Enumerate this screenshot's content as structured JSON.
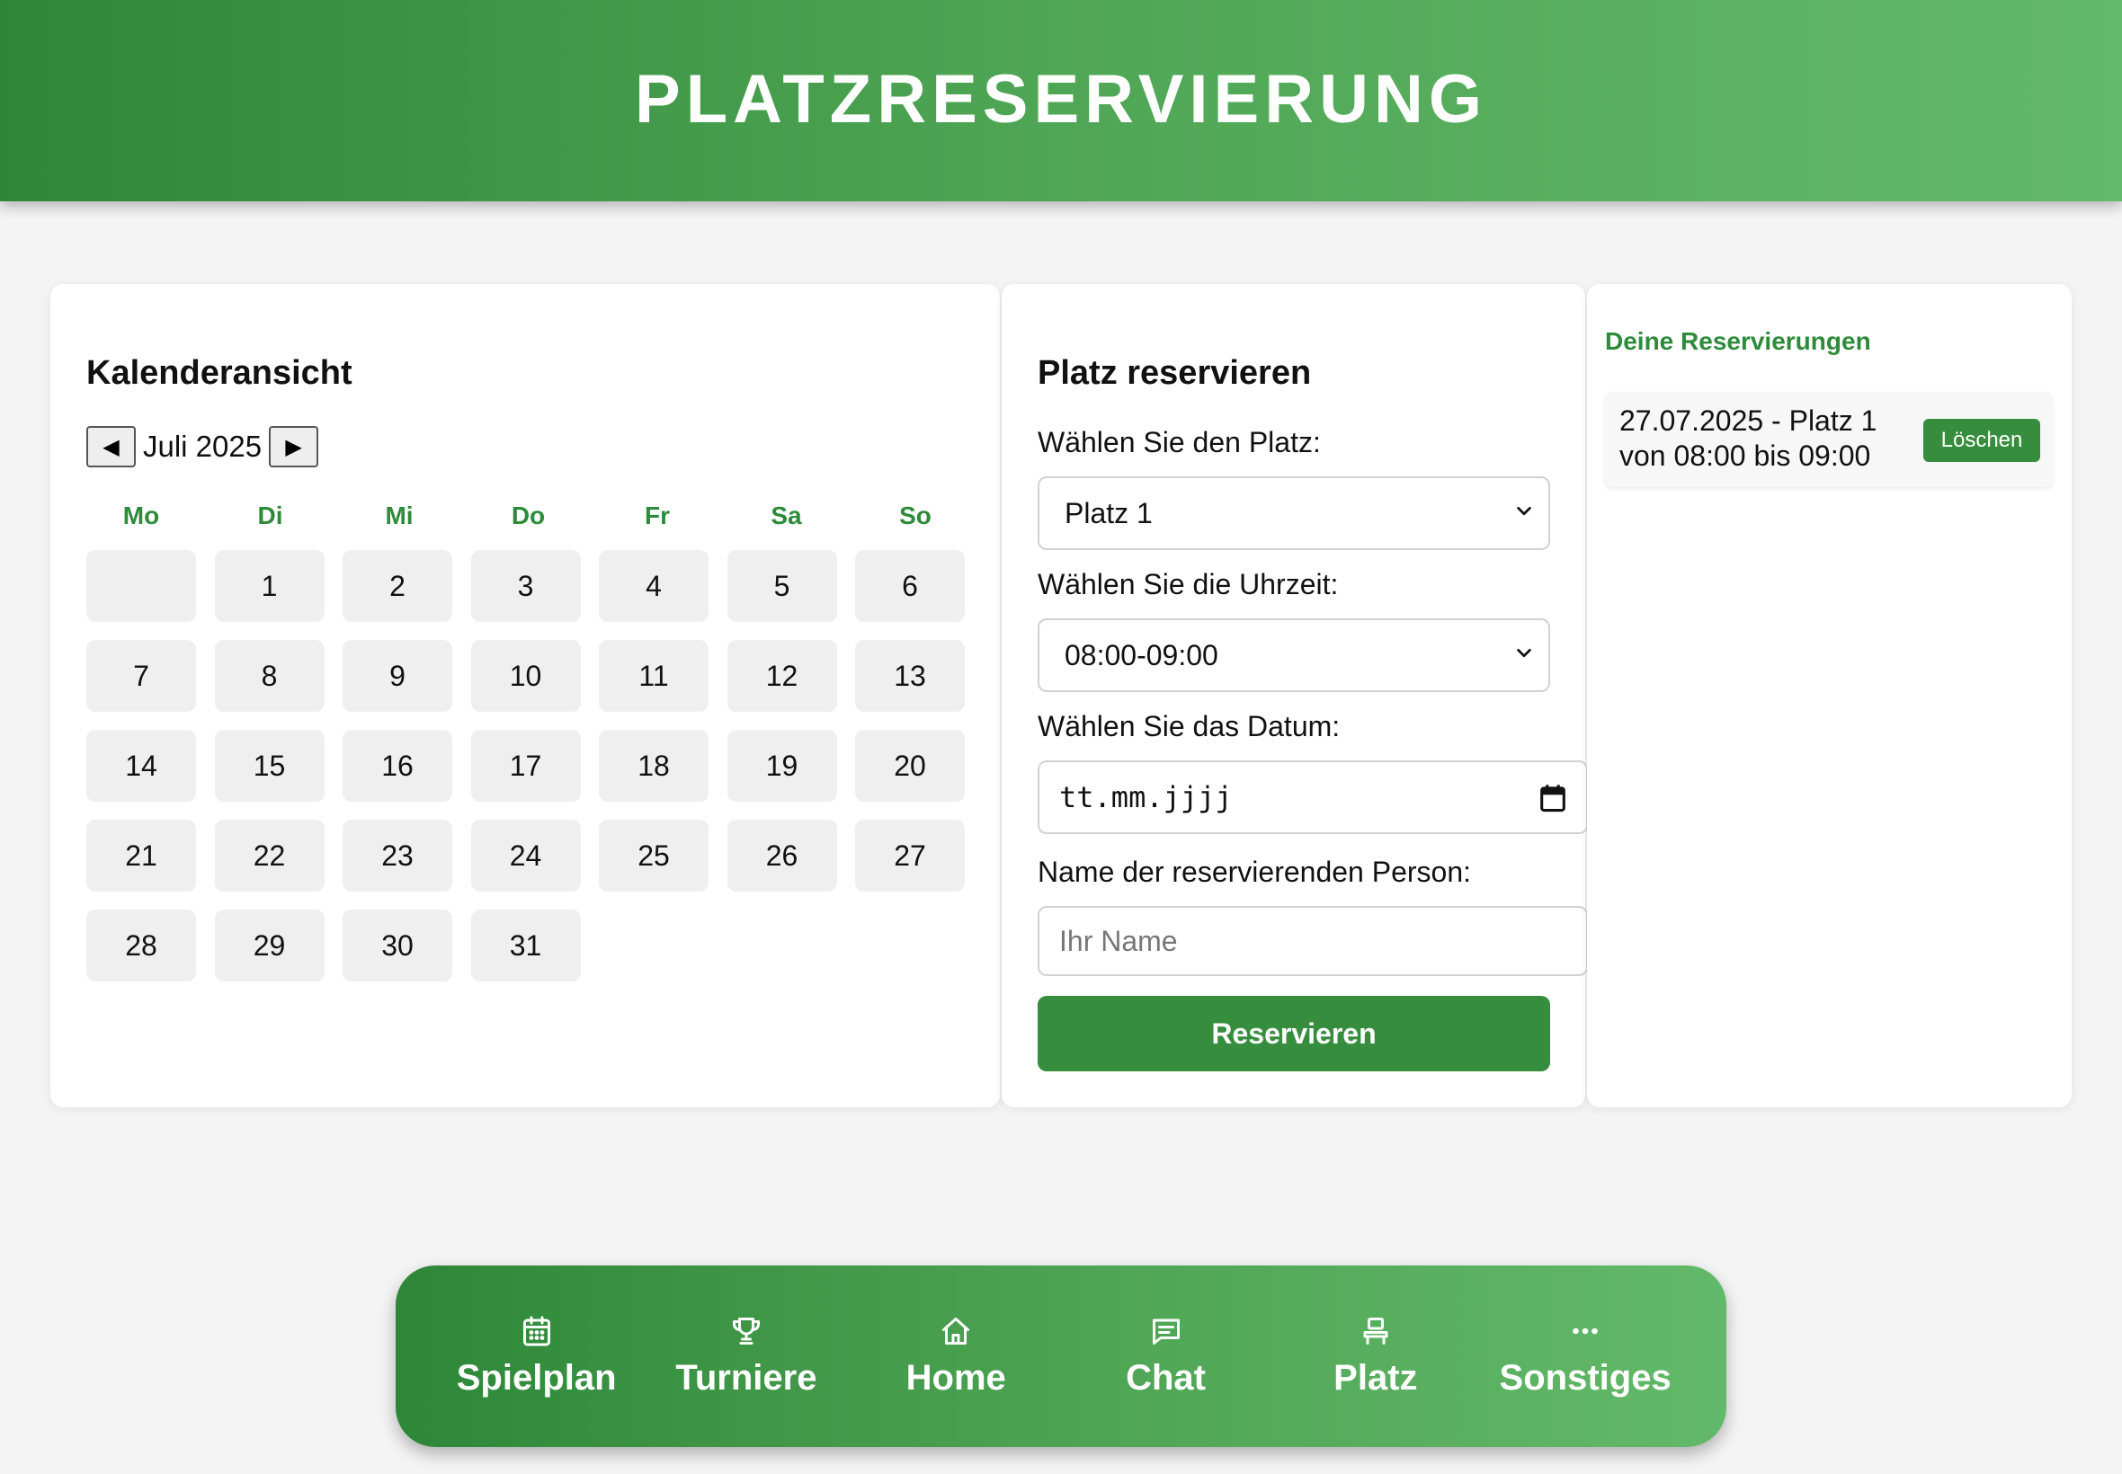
{
  "header": {
    "title": "PLATZRESERVIERUNG"
  },
  "calendar": {
    "title": "Kalenderansicht",
    "prev_symbol": "◀",
    "next_symbol": "▶",
    "month_label": "Juli 2025",
    "weekdays": [
      "Mo",
      "Di",
      "Mi",
      "Do",
      "Fr",
      "Sa",
      "So"
    ],
    "leading_empty": 1,
    "days": [
      "1",
      "2",
      "3",
      "4",
      "5",
      "6",
      "7",
      "8",
      "9",
      "10",
      "11",
      "12",
      "13",
      "14",
      "15",
      "16",
      "17",
      "18",
      "19",
      "20",
      "21",
      "22",
      "23",
      "24",
      "25",
      "26",
      "27",
      "28",
      "29",
      "30",
      "31"
    ]
  },
  "form": {
    "title": "Platz reservieren",
    "court_label": "Wählen Sie den Platz:",
    "court_value": "Platz 1",
    "time_label": "Wählen Sie die Uhrzeit:",
    "time_value": "08:00-09:00",
    "date_label": "Wählen Sie das Datum:",
    "date_placeholder": "tt.mm.jjjj",
    "name_label": "Name der reservierenden Person:",
    "name_placeholder": "Ihr Name",
    "submit_label": "Reservieren"
  },
  "reservations": {
    "title": "Deine Reservierungen",
    "items": [
      {
        "line1": "27.07.2025 - Platz 1",
        "line2": "von 08:00 bis 09:00",
        "delete_label": "Löschen"
      }
    ]
  },
  "bottom_nav": {
    "items": [
      {
        "label": "Spielplan",
        "icon": "calendar-icon"
      },
      {
        "label": "Turniere",
        "icon": "trophy-icon"
      },
      {
        "label": "Home",
        "icon": "home-icon"
      },
      {
        "label": "Chat",
        "icon": "chat-icon"
      },
      {
        "label": "Platz",
        "icon": "court-icon"
      },
      {
        "label": "Sonstiges",
        "icon": "more-icon"
      }
    ]
  },
  "colors": {
    "accent": "#368d3d",
    "accent_light": "#63b96a",
    "weekday": "#2e8b3a",
    "background": "#f4f4f4"
  }
}
